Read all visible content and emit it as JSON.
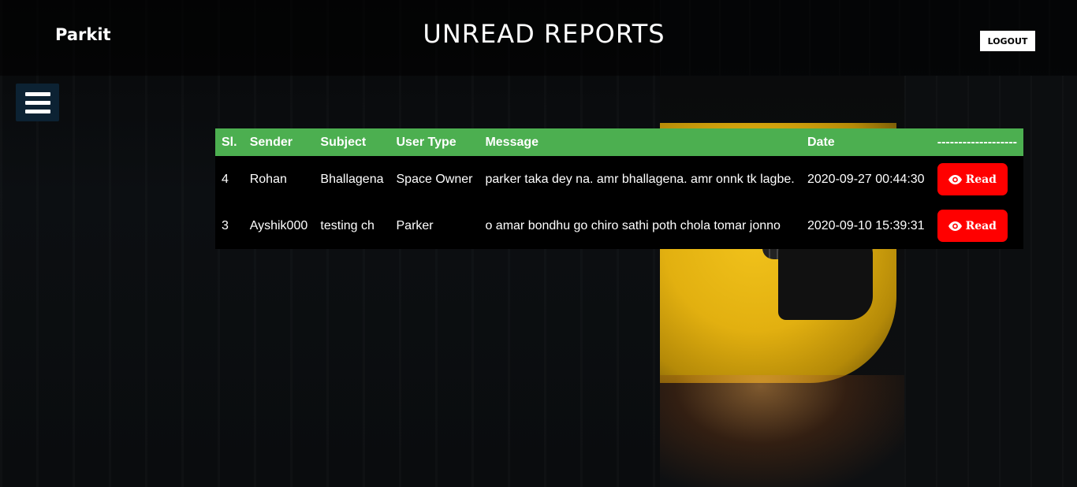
{
  "header": {
    "brand": "Parkit",
    "title": "UNREAD REPORTS",
    "logout_label": "LOGOUT"
  },
  "menu": {
    "icon": "hamburger-icon"
  },
  "table": {
    "columns": [
      "Sl.",
      "Sender",
      "Subject",
      "User Type",
      "Message",
      "Date",
      "-------------------"
    ],
    "rows": [
      {
        "sl": "4",
        "sender": "Rohan",
        "subject": "Bhallagena",
        "user_type": "Space Owner",
        "message": "parker taka dey na. amr bhallagena. amr onnk tk lagbe.",
        "date": "2020-09-27 00:44:30",
        "action_label": "Read"
      },
      {
        "sl": "3",
        "sender": "Ayshik000",
        "subject": "testing ch",
        "user_type": "Parker",
        "message": "o amar bondhu go chiro sathi poth chola tomar jonno",
        "date": "2020-09-10 15:39:31",
        "action_label": "Read"
      }
    ]
  },
  "colors": {
    "header_row": "#4caf50",
    "read_button": "#ff0000",
    "menu_button": "#0c2233"
  }
}
